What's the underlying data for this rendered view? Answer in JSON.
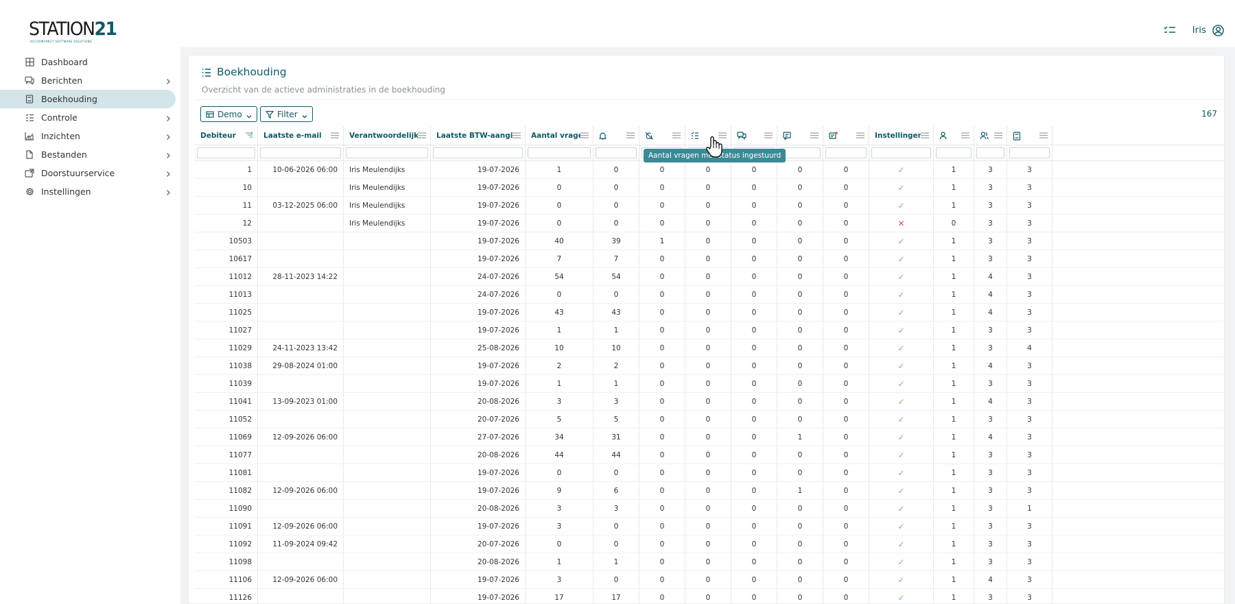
{
  "app": {
    "logo_text": "STATION",
    "logo_number": "21",
    "logo_tagline": "ACCOUNTANCY SOFTWARE SOLUTIONS",
    "user_name": "Iris"
  },
  "sidebar": {
    "items": [
      {
        "label": "Dashboard",
        "icon": "grid-icon",
        "chevron": false,
        "active": false
      },
      {
        "label": "Berichten",
        "icon": "messages-icon",
        "chevron": true,
        "active": false
      },
      {
        "label": "Boekhouding",
        "icon": "book-icon",
        "chevron": false,
        "active": true
      },
      {
        "label": "Controle",
        "icon": "checklist-icon",
        "chevron": true,
        "active": false
      },
      {
        "label": "Inzichten",
        "icon": "chart-icon",
        "chevron": true,
        "active": false
      },
      {
        "label": "Bestanden",
        "icon": "file-icon",
        "chevron": true,
        "active": false
      },
      {
        "label": "Doorstuurservice",
        "icon": "forward-icon",
        "chevron": true,
        "active": false
      },
      {
        "label": "Instellingen",
        "icon": "gear-icon",
        "chevron": true,
        "active": false
      }
    ]
  },
  "page": {
    "title": "Boekhouding",
    "subtitle": "Overzicht van de actieve administraties in de boekhouding",
    "demo_label": "Demo",
    "filter_label": "Filter",
    "count": "167",
    "tooltip": "Aantal vragen met status ingestuurd"
  },
  "table": {
    "headers": [
      "Debiteur",
      "Laatste e-mail",
      "Verantwoordelijke",
      "Laatste BTW-aangifte",
      "Aantal vragen",
      "",
      "",
      "",
      "",
      "",
      "",
      "Instellingen",
      "",
      "",
      ""
    ],
    "header_icons": [
      "sort-icon",
      "",
      "",
      "",
      "",
      "bell-icon",
      "bell-off-icon",
      "list-status-icon",
      "chat-icon",
      "message-icon",
      "notification-icon",
      "",
      "user-icon",
      "users-icon",
      "book-icon"
    ],
    "rows": [
      [
        "1",
        "10-06-2026 06:00",
        "Iris Meulendijks",
        "19-07-2026",
        "1",
        "0",
        "0",
        "0",
        "0",
        "0",
        "0",
        "check",
        "1",
        "3",
        "3"
      ],
      [
        "10",
        "",
        "Iris Meulendijks",
        "19-07-2026",
        "0",
        "0",
        "0",
        "0",
        "0",
        "0",
        "0",
        "check",
        "1",
        "3",
        "3"
      ],
      [
        "11",
        "03-12-2025 06:00",
        "Iris Meulendijks",
        "19-07-2026",
        "0",
        "0",
        "0",
        "0",
        "0",
        "0",
        "0",
        "check",
        "1",
        "3",
        "3"
      ],
      [
        "12",
        "",
        "Iris Meulendijks",
        "19-07-2026",
        "0",
        "0",
        "0",
        "0",
        "0",
        "0",
        "0",
        "cross",
        "0",
        "3",
        "3"
      ],
      [
        "10503",
        "",
        "",
        "19-07-2026",
        "40",
        "39",
        "1",
        "0",
        "0",
        "0",
        "0",
        "check",
        "1",
        "3",
        "3"
      ],
      [
        "10617",
        "",
        "",
        "19-07-2026",
        "7",
        "7",
        "0",
        "0",
        "0",
        "0",
        "0",
        "check",
        "1",
        "3",
        "3"
      ],
      [
        "11012",
        "28-11-2023 14:22",
        "",
        "24-07-2026",
        "54",
        "54",
        "0",
        "0",
        "0",
        "0",
        "0",
        "check",
        "1",
        "4",
        "3"
      ],
      [
        "11013",
        "",
        "",
        "24-07-2026",
        "0",
        "0",
        "0",
        "0",
        "0",
        "0",
        "0",
        "check",
        "1",
        "4",
        "3"
      ],
      [
        "11025",
        "",
        "",
        "19-07-2026",
        "43",
        "43",
        "0",
        "0",
        "0",
        "0",
        "0",
        "check",
        "1",
        "4",
        "3"
      ],
      [
        "11027",
        "",
        "",
        "19-07-2026",
        "1",
        "1",
        "0",
        "0",
        "0",
        "0",
        "0",
        "check",
        "1",
        "3",
        "3"
      ],
      [
        "11029",
        "24-11-2023 13:42",
        "",
        "25-08-2026",
        "10",
        "10",
        "0",
        "0",
        "0",
        "0",
        "0",
        "check",
        "1",
        "3",
        "4"
      ],
      [
        "11038",
        "29-08-2024 01:00",
        "",
        "19-07-2026",
        "2",
        "2",
        "0",
        "0",
        "0",
        "0",
        "0",
        "check",
        "1",
        "4",
        "3"
      ],
      [
        "11039",
        "",
        "",
        "19-07-2026",
        "1",
        "1",
        "0",
        "0",
        "0",
        "0",
        "0",
        "check",
        "1",
        "3",
        "3"
      ],
      [
        "11041",
        "13-09-2023 01:00",
        "",
        "20-08-2026",
        "3",
        "3",
        "0",
        "0",
        "0",
        "0",
        "0",
        "check",
        "1",
        "4",
        "3"
      ],
      [
        "11052",
        "",
        "",
        "20-07-2026",
        "5",
        "5",
        "0",
        "0",
        "0",
        "0",
        "0",
        "check",
        "1",
        "3",
        "3"
      ],
      [
        "11069",
        "12-09-2026 06:00",
        "",
        "27-07-2026",
        "34",
        "31",
        "0",
        "0",
        "0",
        "1",
        "0",
        "check",
        "1",
        "4",
        "3"
      ],
      [
        "11077",
        "",
        "",
        "20-08-2026",
        "44",
        "44",
        "0",
        "0",
        "0",
        "0",
        "0",
        "check",
        "1",
        "3",
        "3"
      ],
      [
        "11081",
        "",
        "",
        "19-07-2026",
        "0",
        "0",
        "0",
        "0",
        "0",
        "0",
        "0",
        "check",
        "1",
        "3",
        "3"
      ],
      [
        "11082",
        "12-09-2026 06:00",
        "",
        "19-07-2026",
        "9",
        "6",
        "0",
        "0",
        "0",
        "1",
        "0",
        "check",
        "1",
        "3",
        "3"
      ],
      [
        "11090",
        "",
        "",
        "20-08-2026",
        "3",
        "3",
        "0",
        "0",
        "0",
        "0",
        "0",
        "check",
        "1",
        "3",
        "1"
      ],
      [
        "11091",
        "12-09-2026 06:00",
        "",
        "19-07-2026",
        "3",
        "0",
        "0",
        "0",
        "0",
        "0",
        "0",
        "check",
        "1",
        "3",
        "3"
      ],
      [
        "11092",
        "11-09-2024 09:42",
        "",
        "20-07-2026",
        "0",
        "0",
        "0",
        "0",
        "0",
        "0",
        "0",
        "check",
        "1",
        "3",
        "3"
      ],
      [
        "11098",
        "",
        "",
        "20-08-2026",
        "1",
        "1",
        "0",
        "0",
        "0",
        "0",
        "0",
        "check",
        "1",
        "3",
        "3"
      ],
      [
        "11106",
        "12-09-2026 06:00",
        "",
        "19-07-2026",
        "3",
        "0",
        "0",
        "0",
        "0",
        "0",
        "0",
        "check",
        "1",
        "4",
        "3"
      ],
      [
        "11126",
        "",
        "",
        "19-07-2026",
        "17",
        "17",
        "0",
        "0",
        "0",
        "0",
        "0",
        "check",
        "1",
        "3",
        "3"
      ]
    ]
  },
  "colors": {
    "brand": "#0f5a66",
    "active_bg": "#d3e5e8",
    "check": "#7fb86e",
    "cross": "#d9534f",
    "tooltip_bg": "#3b8a95"
  }
}
